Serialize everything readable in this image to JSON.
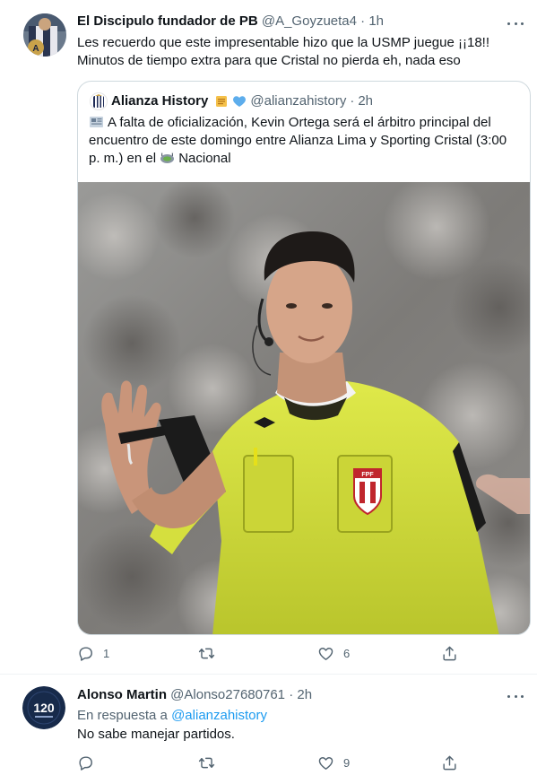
{
  "tweet1": {
    "name": "El Discipulo fundador de PB",
    "handle": "@A_Goyzueta4",
    "dot": "·",
    "time": "1h",
    "text_line1": "Les recuerdo que este impresentable hizo que la USMP juegue ¡¡18!!",
    "text_line2": "Minutos de tiempo extra para que Cristal no pierda eh, nada eso",
    "quote": {
      "name": "Alianza History",
      "handle": "@alianzahistory",
      "dot": "·",
      "time": "2h",
      "line1": "A falta de oficialización, Kevin Ortega será el árbitro principal del",
      "line2": "encuentro de este domingo entre Alianza Lima y Sporting Cristal (3:00",
      "line3_a": "p. m.) en el",
      "line3_b": "Nacional"
    },
    "actions": {
      "reply_count": "1",
      "retweet_count": "",
      "like_count": "6"
    }
  },
  "tweet2": {
    "name": "Alonso Martin",
    "handle": "@Alonso27680761",
    "dot": "·",
    "time": "2h",
    "reply_prefix": "En respuesta a",
    "reply_handle": "@alianzahistory",
    "text": "No sabe manejar partidos.",
    "avatar_text": "120",
    "actions": {
      "reply_count": "",
      "retweet_count": "",
      "like_count": "9"
    }
  },
  "colors": {
    "text": "#0f1419",
    "secondary": "#536471",
    "link": "#1d9bf0",
    "border": "#cfd9de",
    "referee_shirt": "#d7e43a"
  },
  "icons": [
    "more-icon",
    "reply-icon",
    "retweet-icon",
    "like-icon",
    "share-icon",
    "scroll-emoji-icon",
    "blue-heart-icon",
    "newspaper-emoji-icon",
    "stadium-emoji-icon"
  ]
}
